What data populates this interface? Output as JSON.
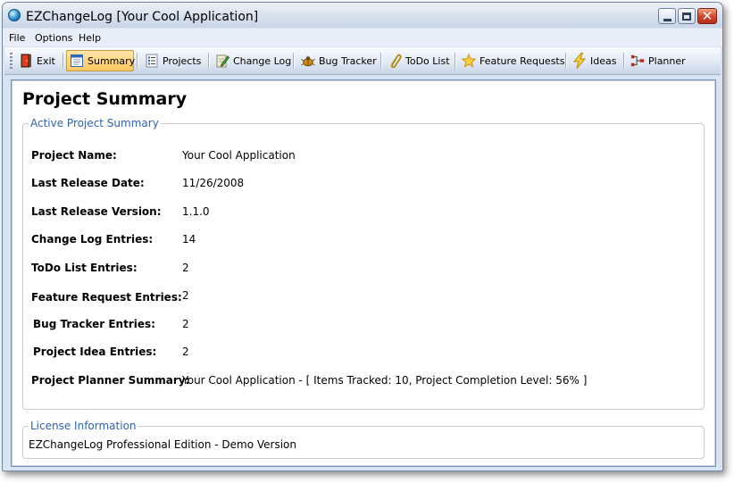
{
  "window": {
    "title": "EZChangeLog [Your Cool Application]"
  },
  "menu": [
    "File",
    "Options",
    "Help"
  ],
  "toolbar": [
    {
      "label": "Exit",
      "icon": "exit-door-icon"
    },
    {
      "label": "Summary",
      "icon": "summary-icon",
      "active": true
    },
    {
      "label": "Projects",
      "icon": "projects-list-icon"
    },
    {
      "label": "Change Log",
      "icon": "notepad-pencil-icon"
    },
    {
      "label": "Bug Tracker",
      "icon": "bug-icon"
    },
    {
      "label": "ToDo List",
      "icon": "paperclip-icon"
    },
    {
      "label": "Feature Requests",
      "icon": "star-icon"
    },
    {
      "label": "Ideas",
      "icon": "lightning-icon"
    },
    {
      "label": "Planner",
      "icon": "planner-flow-icon"
    }
  ],
  "page": {
    "title": "Project Summary"
  },
  "summary": {
    "legend": "Active Project Summary",
    "rows": [
      {
        "label": "Project Name:",
        "value": "Your Cool Application"
      },
      {
        "label": "Last Release Date:",
        "value": "11/26/2008"
      },
      {
        "label": "Last Release Version:",
        "value": "1.1.0"
      },
      {
        "label": "Change Log Entries:",
        "value": "14"
      },
      {
        "label": "ToDo List Entries:",
        "value": "2"
      },
      {
        "label": "Feature Request Entries:",
        "value": "2"
      },
      {
        "label": "Bug Tracker Entries:",
        "value": "2"
      },
      {
        "label": "Project Idea Entries:",
        "value": "2"
      },
      {
        "label": "Project Planner Summary:",
        "value": "Your Cool Application - [ Items Tracked: 10, Project Completion Level: 56% ]"
      }
    ]
  },
  "license": {
    "legend": "License Information",
    "text": "EZChangeLog Professional Edition - Demo Version"
  },
  "colors": {
    "accent": "#2d62b3",
    "active_button": "#ffc661",
    "close_button": "#d2442a"
  }
}
